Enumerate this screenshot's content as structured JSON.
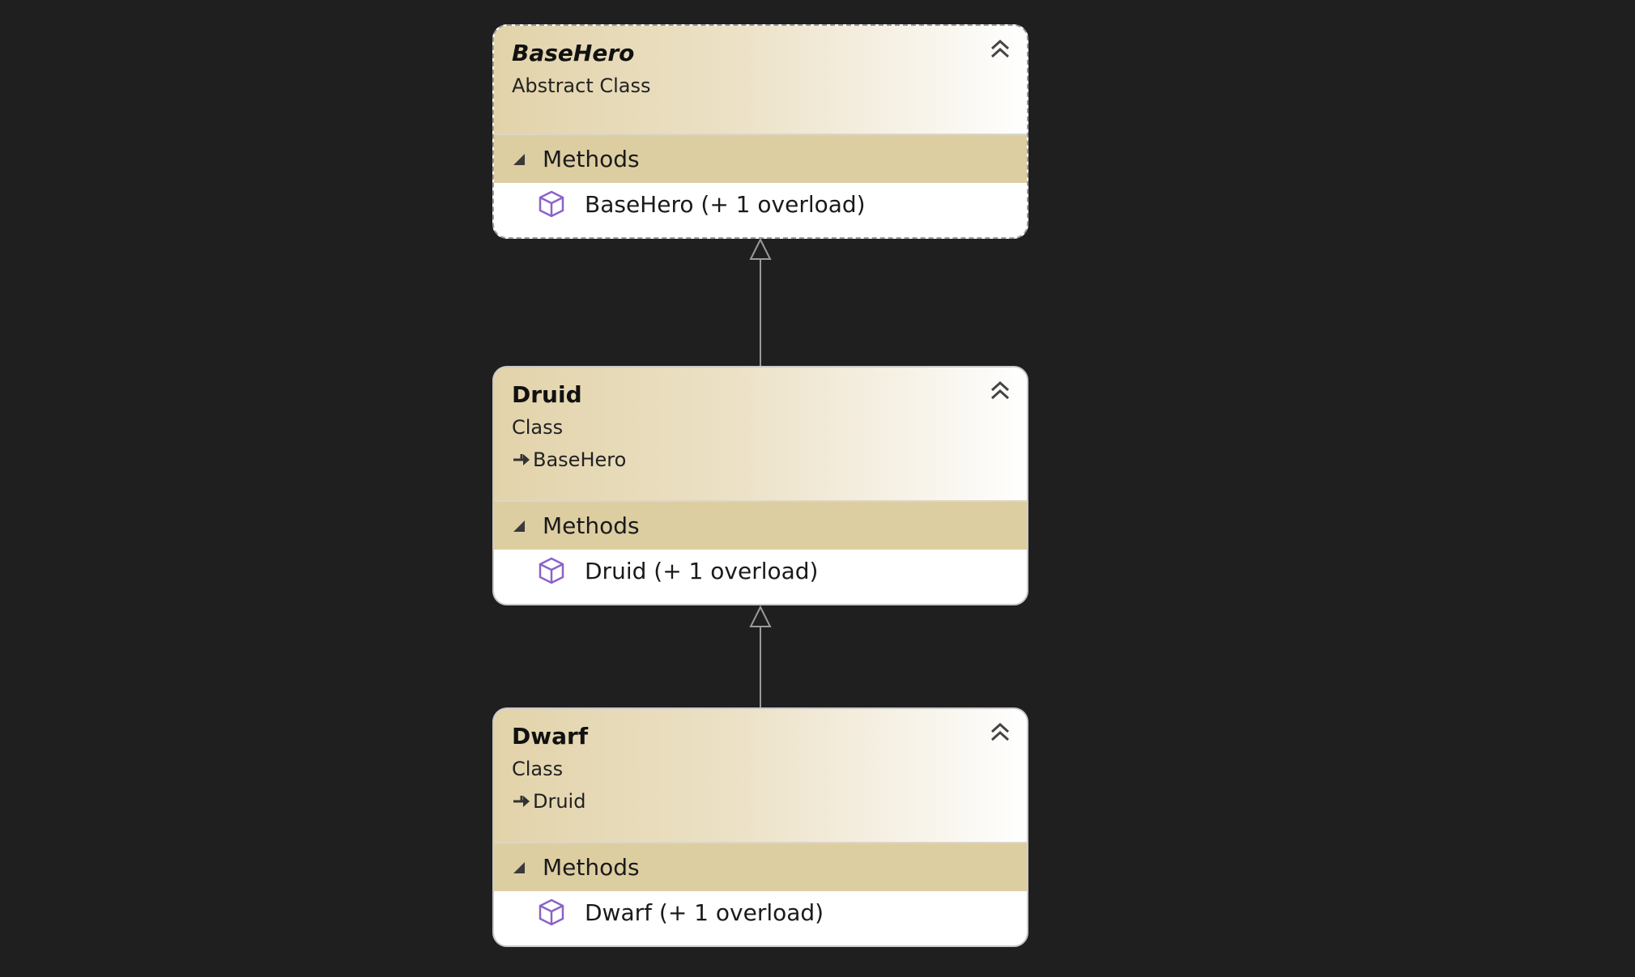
{
  "classes": [
    {
      "name": "BaseHero",
      "kind": "Abstract Class",
      "base": null,
      "section_label": "Methods",
      "members": [
        "BaseHero (+ 1 overload)"
      ],
      "icons": [
        "collapse-chevron-up-icon",
        "expand-triangle-icon",
        "method-cube-icon"
      ]
    },
    {
      "name": "Druid",
      "kind": "Class",
      "base": "BaseHero",
      "section_label": "Methods",
      "members": [
        "Druid (+ 1 overload)"
      ],
      "icons": [
        "collapse-chevron-up-icon",
        "inheritance-arrow-icon",
        "expand-triangle-icon",
        "method-cube-icon"
      ]
    },
    {
      "name": "Dwarf",
      "kind": "Class",
      "base": "Druid",
      "section_label": "Methods",
      "members": [
        "Dwarf (+ 1 overload)"
      ],
      "icons": [
        "collapse-chevron-up-icon",
        "inheritance-arrow-icon",
        "expand-triangle-icon",
        "method-cube-icon"
      ]
    }
  ],
  "relationships": [
    {
      "from": "Druid",
      "to": "BaseHero",
      "type": "inheritance"
    },
    {
      "from": "Dwarf",
      "to": "Druid",
      "type": "inheritance"
    }
  ],
  "colors": {
    "background": "#1f1f1f",
    "header_gradient_start": "#e2d3aa",
    "section_header": "#ddcea2",
    "method_icon": "#8a63c8",
    "connector": "#9a9a9a"
  }
}
